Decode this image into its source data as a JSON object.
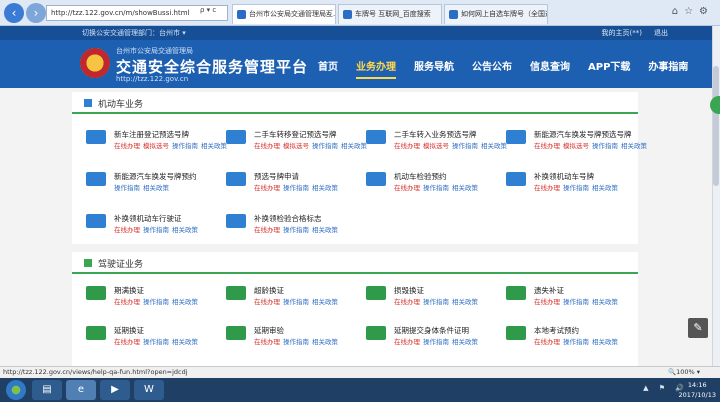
{
  "browser": {
    "address": "http://tzz.122.gov.cn/m/showBussi.html",
    "address_tools": "ρ ▾ c",
    "tabs": [
      {
        "label": "台州市公安局交通管理局互..."
      },
      {
        "label": "车牌号 互联网_百度搜索"
      },
      {
        "label": "如何网上自选车牌号（全国通..."
      }
    ],
    "window_tools": "⌂☆⚙"
  },
  "header": {
    "dept_switch": "切换公安交通管理部门：台州市 ▾",
    "login": "我的主页(**)",
    "logout": "退出",
    "agency": "台州市公安局交通管理局",
    "title": "交通安全综合服务管理平台",
    "url": "http://tzz.122.gov.cn",
    "nav": [
      "首页",
      "业务办理",
      "服务导航",
      "公告公布",
      "信息查询",
      "APP下载",
      "办事指南"
    ],
    "active_nav": "业务办理"
  },
  "links": {
    "online": "在线办理",
    "model": "模拟选号",
    "guide": "操作指南",
    "policy": "相关政策"
  },
  "vehicle_section": {
    "title": "机动车业务",
    "items": [
      {
        "name": "新车注册登记预选号牌",
        "icon": "car-plate-icon",
        "links": [
          "online",
          "model",
          "guide",
          "policy"
        ]
      },
      {
        "name": "二手车转移登记预选号牌",
        "icon": "car-plate-icon",
        "links": [
          "online",
          "model",
          "guide",
          "policy"
        ]
      },
      {
        "name": "二手车转入业务预选号牌",
        "icon": "car-plate-icon",
        "links": [
          "online",
          "model",
          "guide",
          "policy"
        ]
      },
      {
        "name": "新能源汽车换发号牌预选号牌",
        "icon": "ev-plate-icon",
        "links": [
          "online",
          "model",
          "guide",
          "policy"
        ]
      },
      {
        "name": "新能源汽车换发号牌预约",
        "icon": "ev-car-icon",
        "links": [
          "guide",
          "policy"
        ]
      },
      {
        "name": "预选号牌申请",
        "icon": "plate-apply-icon",
        "links": [
          "online",
          "guide",
          "policy"
        ]
      },
      {
        "name": "机动车检验预约",
        "icon": "inspection-icon",
        "links": [
          "online",
          "guide",
          "policy"
        ]
      },
      {
        "name": "补换领机动车号牌",
        "icon": "plate-replace-icon",
        "links": [
          "online",
          "guide",
          "policy"
        ]
      },
      {
        "name": "补换领机动车行驶证",
        "icon": "license-replace-icon",
        "links": [
          "online",
          "guide",
          "policy"
        ]
      },
      {
        "name": "补换领检验合格标志",
        "icon": "inspection-mark-icon",
        "links": [
          "online",
          "guide",
          "policy"
        ]
      }
    ]
  },
  "driver_section": {
    "title": "驾驶证业务",
    "items": [
      {
        "name": "期满换证",
        "icon": "license-renew-icon",
        "links": [
          "online",
          "guide",
          "policy"
        ]
      },
      {
        "name": "超龄换证",
        "icon": "license-age-icon",
        "links": [
          "online",
          "guide",
          "policy"
        ]
      },
      {
        "name": "损毁换证",
        "icon": "license-damage-icon",
        "links": [
          "online",
          "guide",
          "policy"
        ]
      },
      {
        "name": "遗失补证",
        "icon": "license-lost-icon",
        "links": [
          "online",
          "guide",
          "policy"
        ]
      },
      {
        "name": "延期换证",
        "icon": "license-extend-icon",
        "links": [
          "online",
          "guide",
          "policy"
        ]
      },
      {
        "name": "延期审验",
        "icon": "review-extend-icon",
        "links": [
          "online",
          "guide",
          "policy"
        ]
      },
      {
        "name": "延期提交身体条件证明",
        "icon": "health-proof-icon",
        "links": [
          "online",
          "guide",
          "policy"
        ]
      },
      {
        "name": "本地考试预约",
        "icon": "exam-booking-icon",
        "links": [
          "online",
          "guide",
          "policy"
        ]
      }
    ]
  },
  "status": {
    "url": "http://tzz.122.gov.cn/views/help-qa-fun.html?open=jdcdj",
    "zoom": "🔍100% ▾"
  },
  "taskbar": {
    "time": "14:16",
    "date": "2017/10/13",
    "tray": "▲ ⚑ 🔊"
  }
}
